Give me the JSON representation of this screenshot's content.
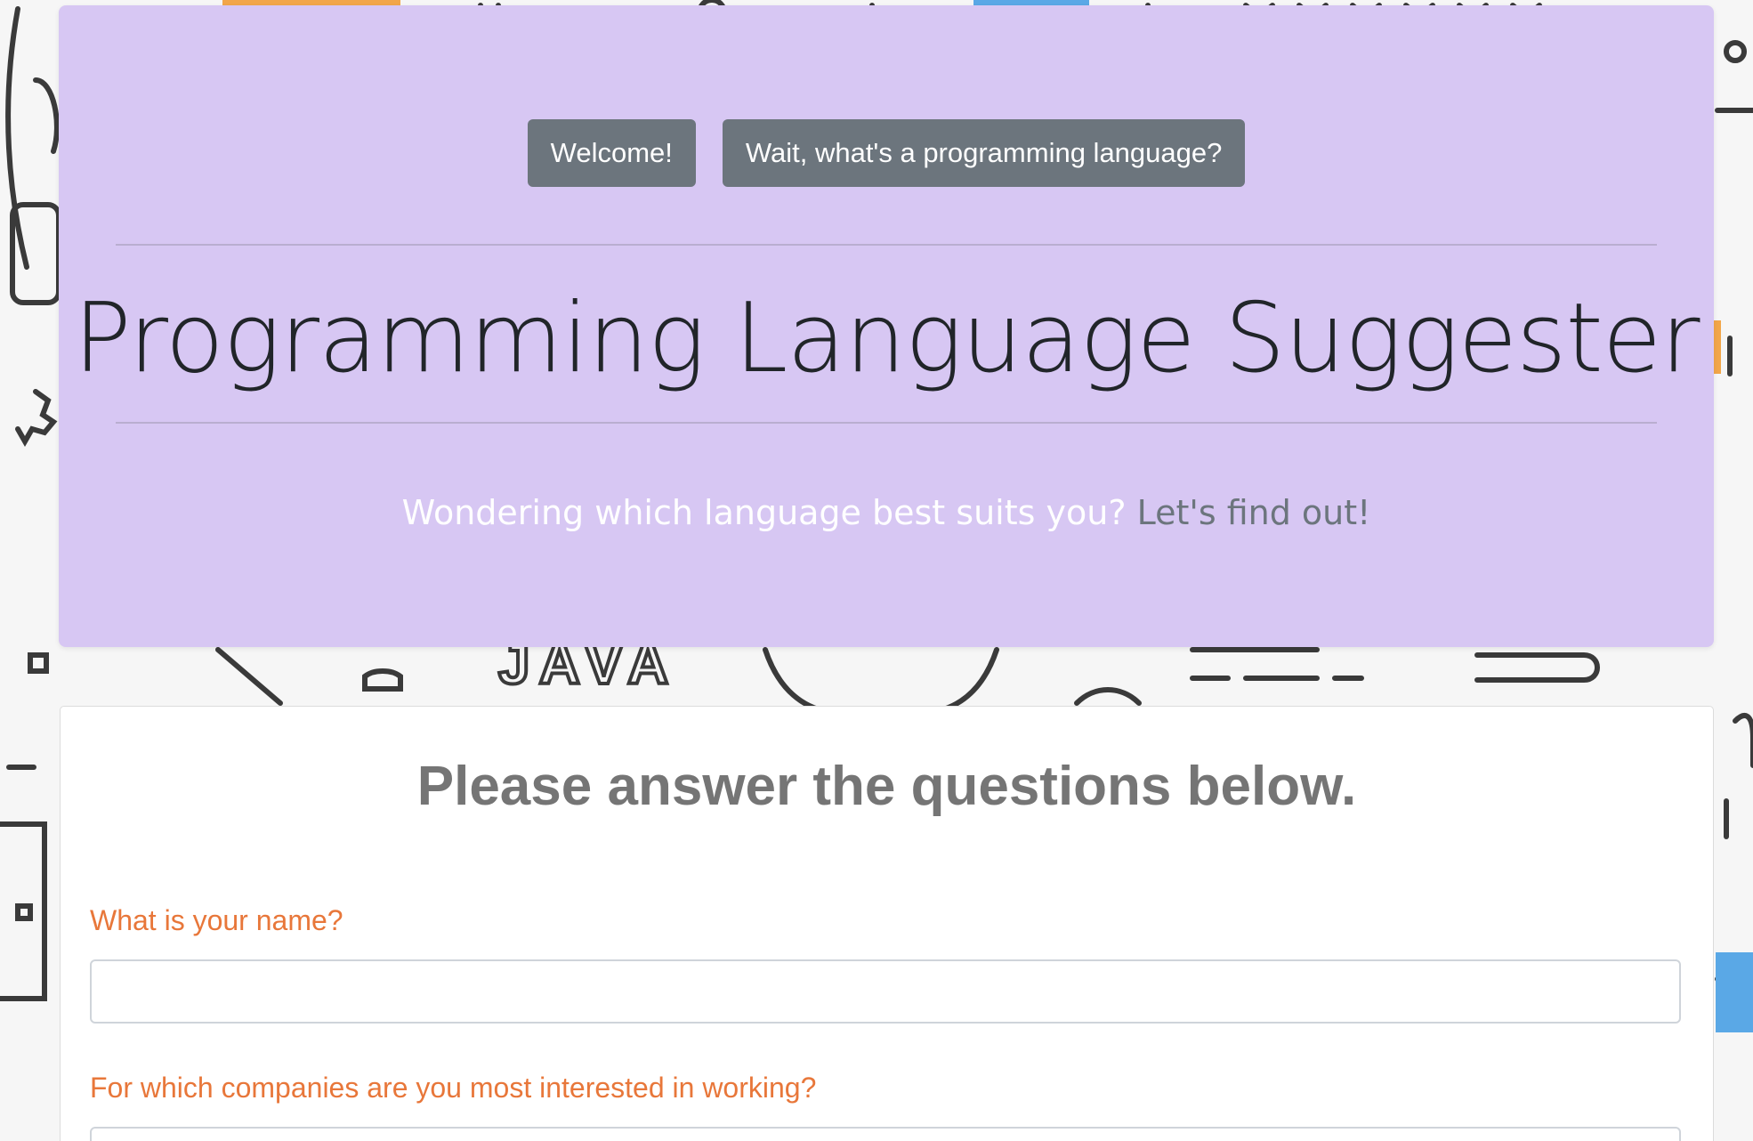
{
  "header": {
    "buttons": {
      "welcome": "Welcome!",
      "what_is": "Wait, what's a programming language?"
    },
    "title": "Programming Language Suggester",
    "lead": "Wondering which language best suits you?",
    "lead_link": "Let's find out!"
  },
  "background": {
    "doodle_text": "JAVA"
  },
  "form": {
    "heading": "Please answer the questions below.",
    "questions": [
      {
        "label": "What is your name?",
        "value": ""
      },
      {
        "label": "For which companies are you most interested in working?",
        "value": ""
      }
    ]
  },
  "colors": {
    "jumbotron_bg": "#d7c7f3",
    "button_bg": "#6c757d",
    "question_label": "#e8773a",
    "heading_text": "#757575"
  }
}
